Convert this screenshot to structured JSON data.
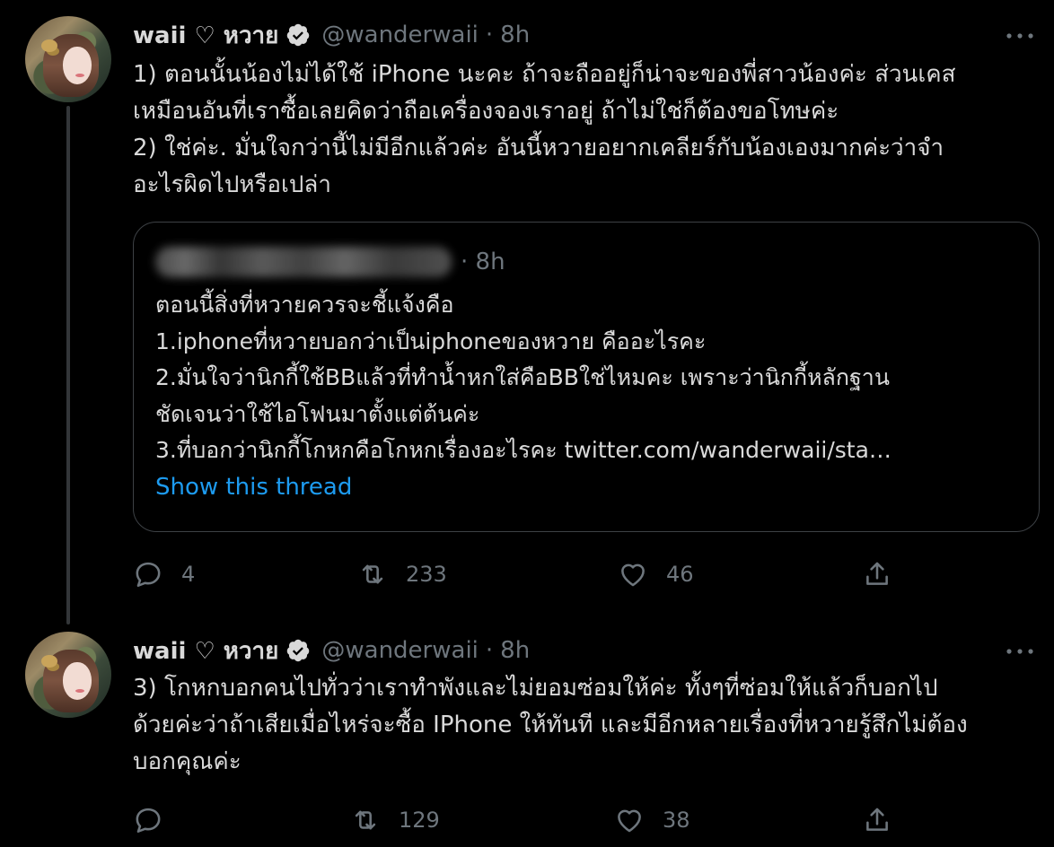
{
  "tweets": [
    {
      "display_name": "waii ♡ หวาย",
      "handle": "@wanderwaii",
      "separator": "·",
      "time": "8h",
      "text": "1) ตอนนั้นน้องไม่ได้ใช้ iPhone นะคะ ถ้าจะถืออยู่ก็น่าจะของพี่สาวน้องค่ะ ส่วนเคส\nเหมือนอันที่เราซื้อเลยคิดว่าถือเครื่องจองเราอยู่ ถ้าไม่ใช่ก็ต้องขอโทษค่ะ\n2) ใช่ค่ะ. มั่นใจกว่านี้ไม่มีอีกแล้วค่ะ อันนี้หวายอยากเคลียร์กับน้องเองมากค่ะว่าจำ\nอะไรผิดไปหรือเปล่า",
      "quote": {
        "time": "· 8h",
        "text": "ตอนนี้สิ่งที่หวายควรจะชี้แจ้งคือ\n1.iphoneที่หวายบอกว่าเป็นiphoneของหวาย คืออะไรคะ\n2.มั่นใจว่านิกกี้ใช้BBแล้วที่ทำน้ำหกใส่คือBBใช่ไหมคะ เพราะว่านิกกี้หลักฐาน\nชัดเจนว่าใช้ไอโฟนมาตั้งแต่ต้นค่ะ\n3.ที่บอกว่านิกกี้โกหกคือโกหกเรื่องอะไรคะ twitter.com/wanderwaii/sta…",
        "show_thread": "Show this thread"
      },
      "replies": "4",
      "retweets": "233",
      "likes": "46"
    },
    {
      "display_name": "waii ♡ หวาย",
      "handle": "@wanderwaii",
      "separator": "·",
      "time": "8h",
      "text": "3) โกหกบอกคนไปทั่วว่าเราทำพังและไม่ยอมซ่อมให้ค่ะ ทั้งๆที่ซ่อมให้แล้วก็บอกไป\nด้วยค่ะว่าถ้าเสียเมื่อไหร่จะซื้อ IPhone ให้ทันที และมีอีกหลายเรื่องที่หวายรู้สึกไม่ต้อง\nบอกคุณค่ะ",
      "replies": "",
      "retweets": "129",
      "likes": "38"
    }
  ],
  "colors": {
    "background": "#000000",
    "text_primary": "#d9d9d9",
    "text_secondary": "#6e767d",
    "link": "#1d9bf0",
    "border": "#3d4145"
  },
  "icons": {
    "verified": "verified-badge-icon",
    "more": "more-horizontal-icon",
    "reply": "reply-icon",
    "retweet": "retweet-icon",
    "like": "heart-icon",
    "share": "share-icon"
  }
}
